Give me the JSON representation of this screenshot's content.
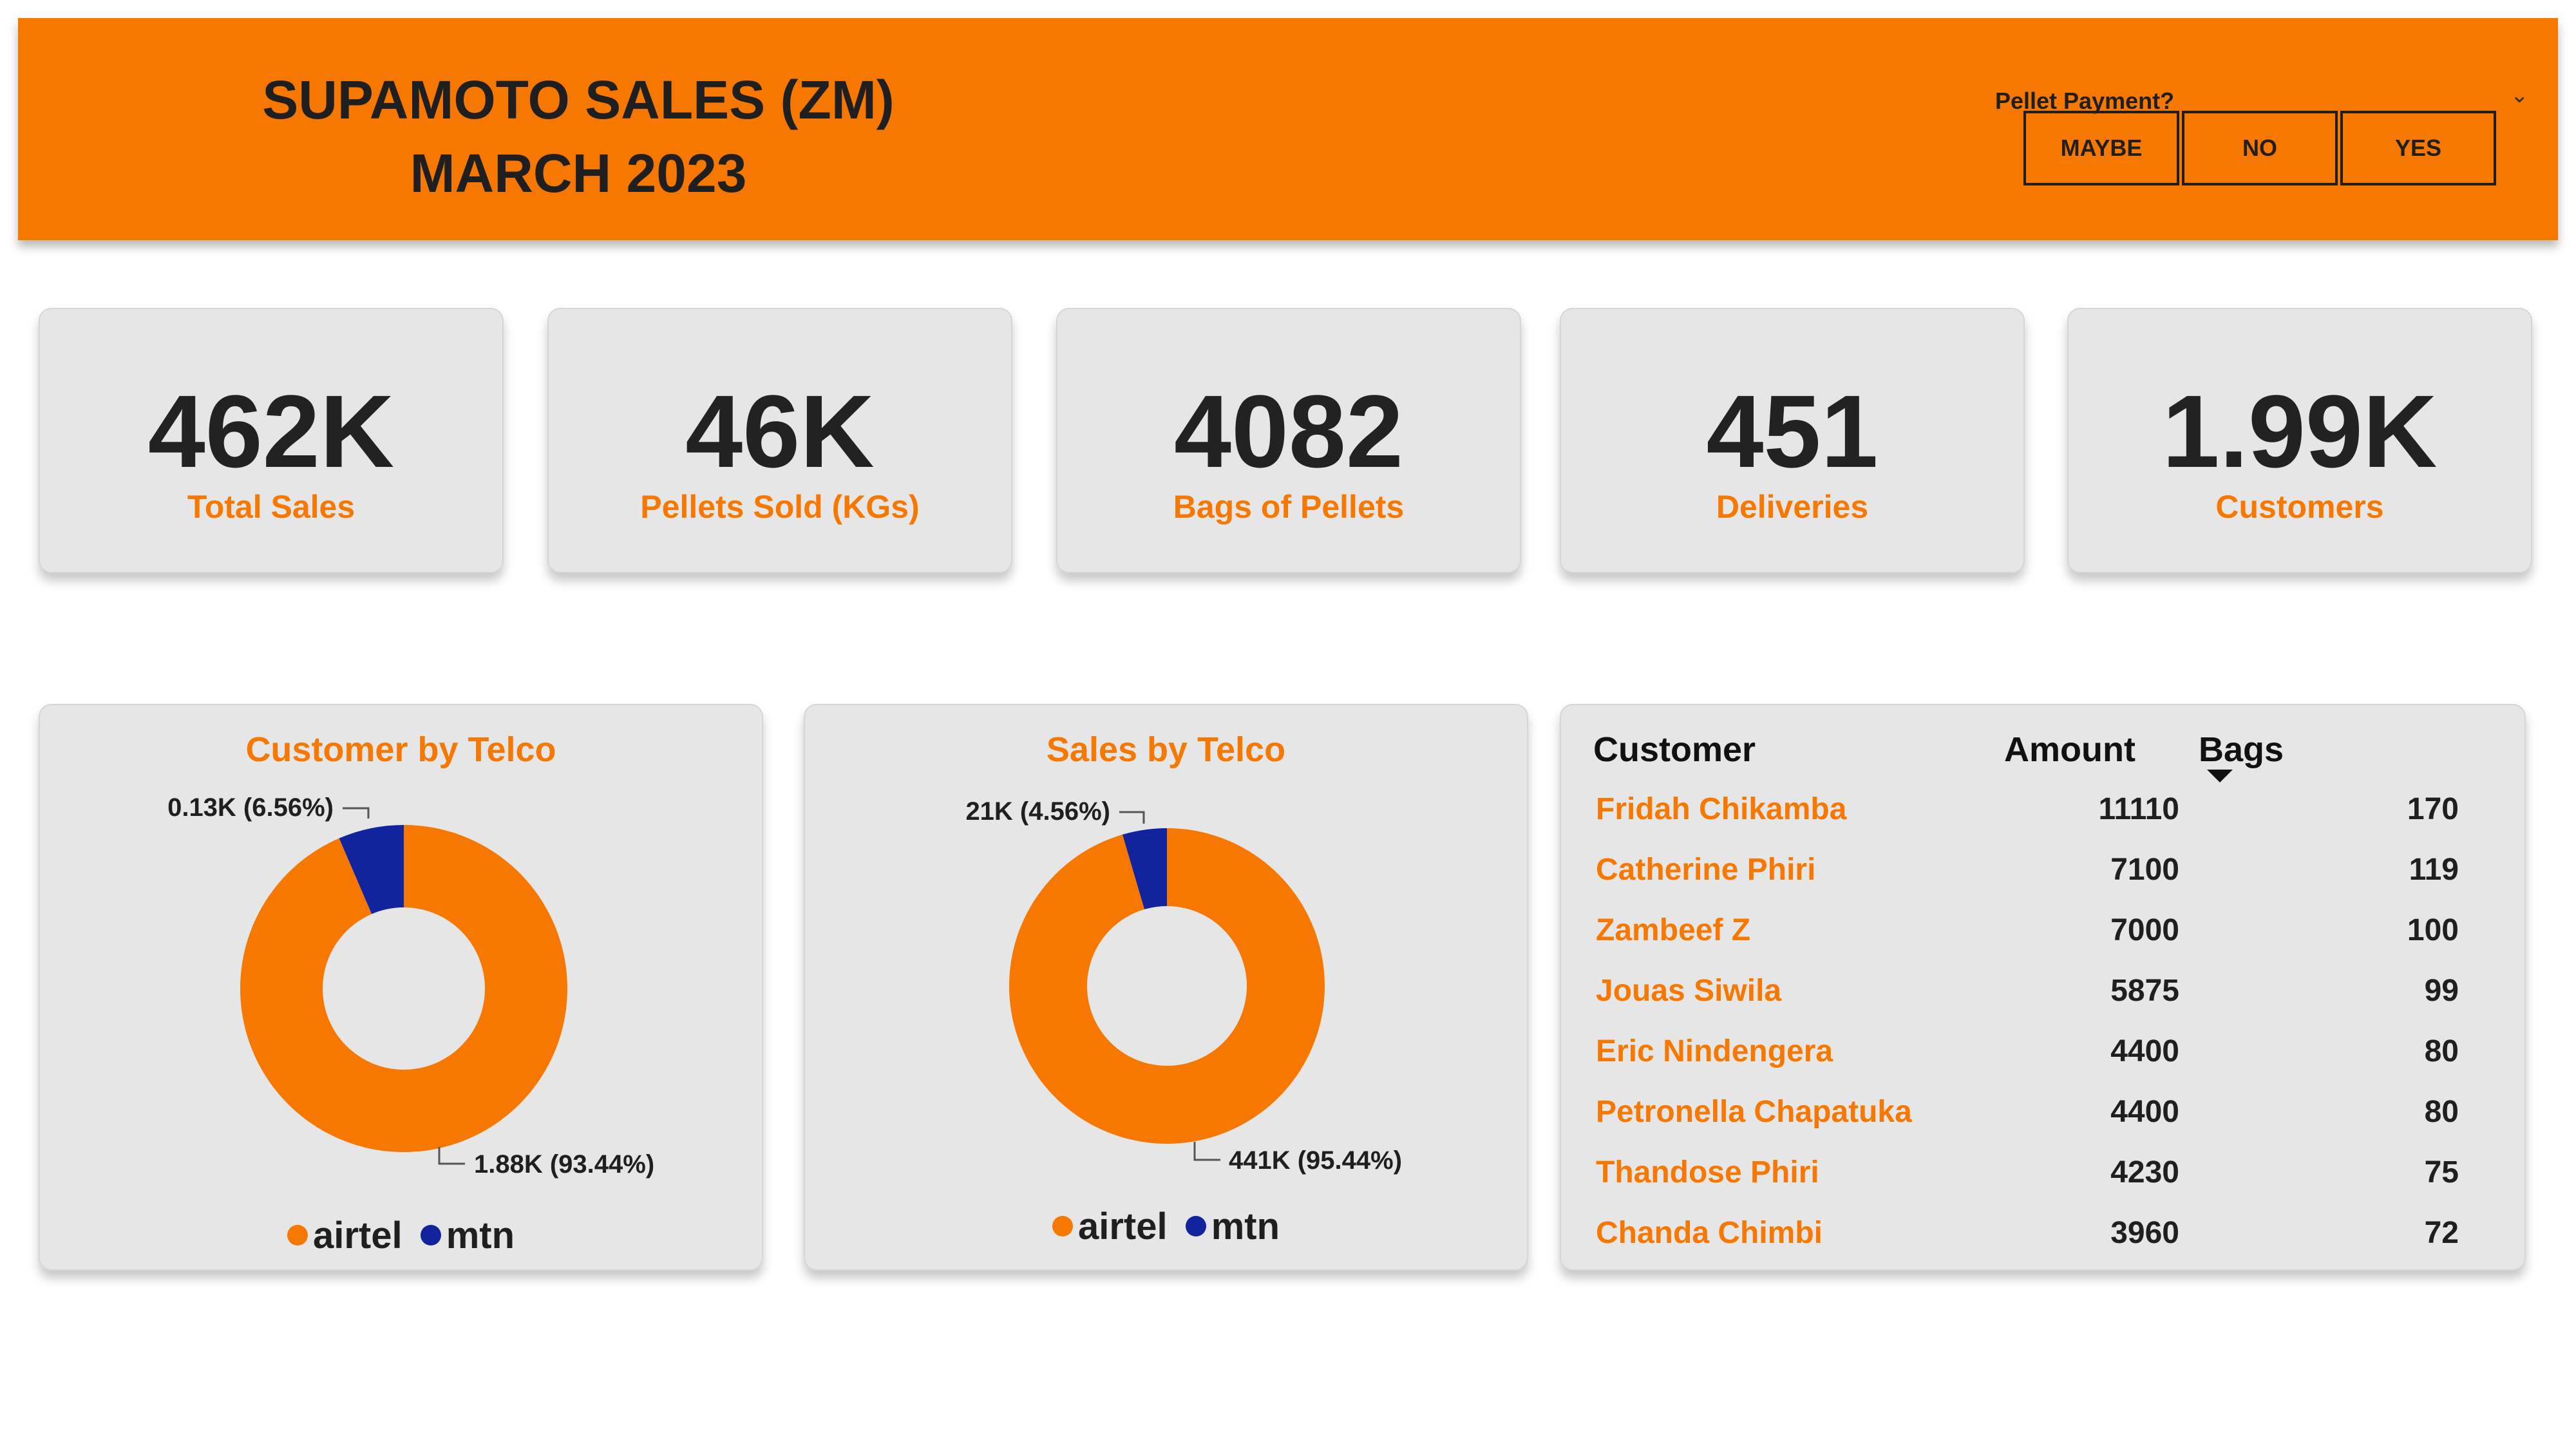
{
  "header": {
    "title_line1": "SUPAMOTO SALES (ZM)",
    "title_line2": "MARCH 2023",
    "slicer": {
      "label": "Pellet Payment?",
      "options": [
        "MAYBE",
        "NO",
        "YES"
      ]
    }
  },
  "kpis": [
    {
      "value": "462K",
      "label": "Total Sales"
    },
    {
      "value": "46K",
      "label": "Pellets Sold (KGs)"
    },
    {
      "value": "4082",
      "label": "Bags of Pellets"
    },
    {
      "value": "451",
      "label": "Deliveries"
    },
    {
      "value": "1.99K",
      "label": "Customers"
    }
  ],
  "customer_by_telco": {
    "title": "Customer by Telco",
    "small_label": "0.13K (6.56%)",
    "large_label": "1.88K (93.44%)"
  },
  "sales_by_telco": {
    "title": "Sales by Telco",
    "small_label": "21K (4.56%)",
    "large_label": "441K (95.44%)"
  },
  "legend": [
    {
      "name": "airtel",
      "color": "#F77800"
    },
    {
      "name": "mtn",
      "color": "#12239E"
    }
  ],
  "chart_data": [
    {
      "type": "pie",
      "title": "Customer by Telco",
      "categories": [
        "airtel",
        "mtn"
      ],
      "values": [
        1880,
        130
      ],
      "percent": [
        93.44,
        6.56
      ],
      "donut": true,
      "colors": [
        "#F77800",
        "#12239E"
      ]
    },
    {
      "type": "pie",
      "title": "Sales by Telco",
      "categories": [
        "airtel",
        "mtn"
      ],
      "values": [
        441000,
        21000
      ],
      "percent": [
        95.44,
        4.56
      ],
      "donut": true,
      "colors": [
        "#F77800",
        "#12239E"
      ]
    }
  ],
  "table": {
    "columns": [
      "Customer",
      "Amount",
      "Bags"
    ],
    "rows": [
      {
        "customer": "Fridah Chikamba",
        "amount": "11110",
        "bags": "170"
      },
      {
        "customer": "Catherine Phiri",
        "amount": "7100",
        "bags": "119"
      },
      {
        "customer": "Zambeef Z",
        "amount": "7000",
        "bags": "100"
      },
      {
        "customer": "Jouas Siwila",
        "amount": "5875",
        "bags": "99"
      },
      {
        "customer": "Eric Nindengera",
        "amount": "4400",
        "bags": "80"
      },
      {
        "customer": "Petronella Chapatuka",
        "amount": "4400",
        "bags": "80"
      },
      {
        "customer": "Thandose Phiri",
        "amount": "4230",
        "bags": "75"
      },
      {
        "customer": "Chanda Chimbi",
        "amount": "3960",
        "bags": "72"
      }
    ]
  },
  "colors": {
    "accent": "#F77800",
    "mtn": "#12239E",
    "card_bg": "#E6E6E6"
  }
}
